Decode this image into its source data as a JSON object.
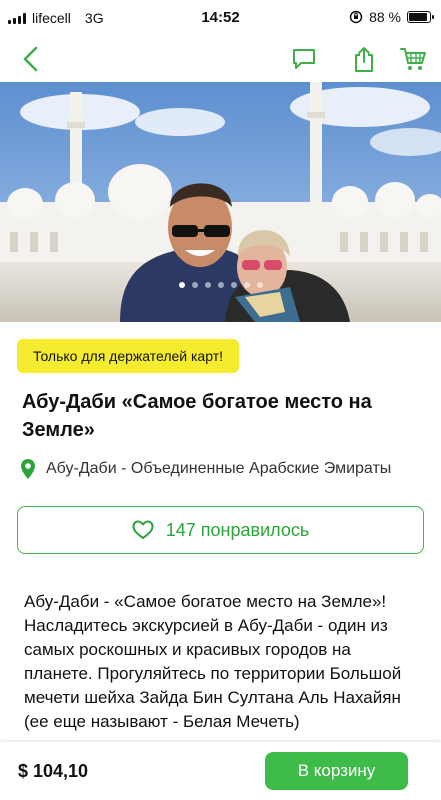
{
  "status_bar": {
    "carrier": "lifecell",
    "network": "3G",
    "time": "14:52",
    "battery_percent": "88 %",
    "battery_level": 0.88
  },
  "nav": {
    "back_icon": "chevron-left-icon",
    "icons": [
      "chat-icon",
      "share-icon",
      "cart-icon"
    ],
    "accent_color": "#3fb049"
  },
  "hero": {
    "slide_count": 7,
    "active_slide": 0
  },
  "badge": {
    "label": "Только для держателей карт!",
    "color": "#f5ec2f"
  },
  "product": {
    "title": "Абу-Даби «Самое богатое место на Земле»",
    "location": "Абу-Даби - Объединенные Арабские Эмираты",
    "likes_label": "147 понравилось",
    "description": "Абу-Даби - «Самое богатое место на Земле»! Насладитесь экскурсией в Абу-Даби - один из самых роскошных и красивых городов на планете. Прогуляйтесь по территории Большой мечети шейха Зайда Бин Султана Аль Нахайян (ее еще называют - Белая Мечеть)"
  },
  "bottom": {
    "price": "$ 104,10",
    "cart_label": "В корзину",
    "button_color": "#3fbb4a"
  }
}
